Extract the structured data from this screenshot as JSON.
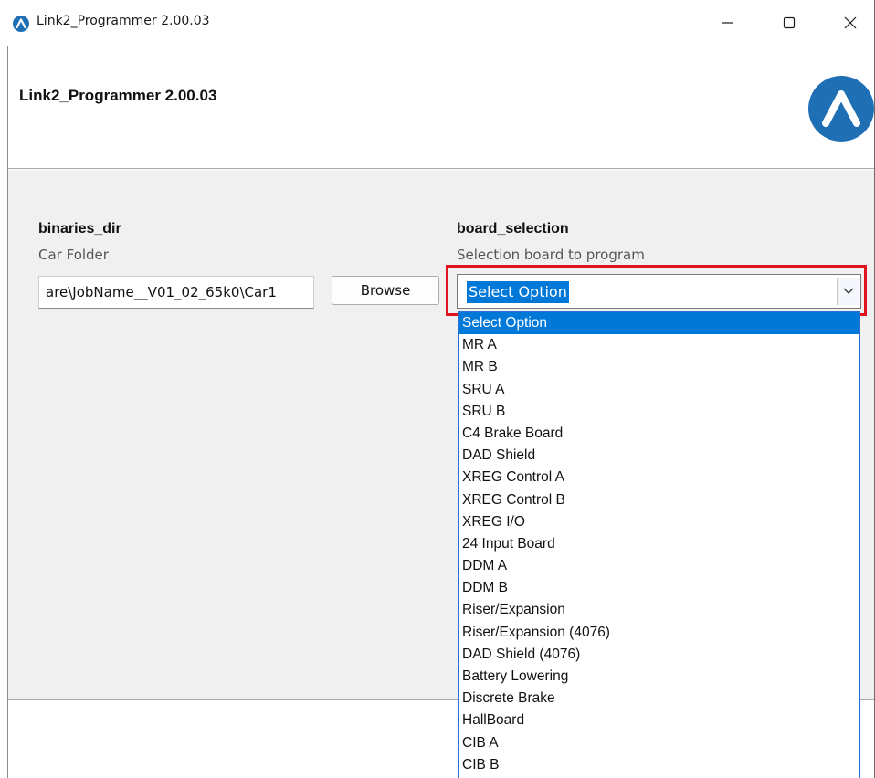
{
  "window": {
    "title": "Link2_Programmer 2.00.03",
    "controls": {
      "minimize_glyph": "—",
      "maximize_glyph": "☐",
      "close_glyph": "✕"
    }
  },
  "header": {
    "title": "Link2_Programmer 2.00.03",
    "logo_icon": "chevron-up-logo-icon",
    "logo_color": "#1f6fb5"
  },
  "binaries_dir": {
    "label": "binaries_dir",
    "sublabel": "Car Folder",
    "value": "are\\JobName__V01_02_65k0\\Car1",
    "browse_label": "Browse"
  },
  "board_selection": {
    "label": "board_selection",
    "sublabel": "Selection board to program",
    "selected": "Select Option",
    "arrow_glyph": "⌵",
    "options": [
      "Select Option",
      "MR A",
      "MR B",
      "SRU A",
      "SRU B",
      "C4 Brake Board",
      "DAD Shield",
      "XREG Control A",
      "XREG Control B",
      "XREG I/O",
      "24 Input Board",
      "DDM A",
      "DDM B",
      "Riser/Expansion",
      "Riser/Expansion (4076)",
      "DAD Shield (4076)",
      "Battery Lowering",
      "Discrete Brake",
      "HallBoard",
      "CIB A",
      "CIB B"
    ]
  },
  "colors": {
    "accent": "#0078d7",
    "highlight_border": "#e0141e"
  }
}
